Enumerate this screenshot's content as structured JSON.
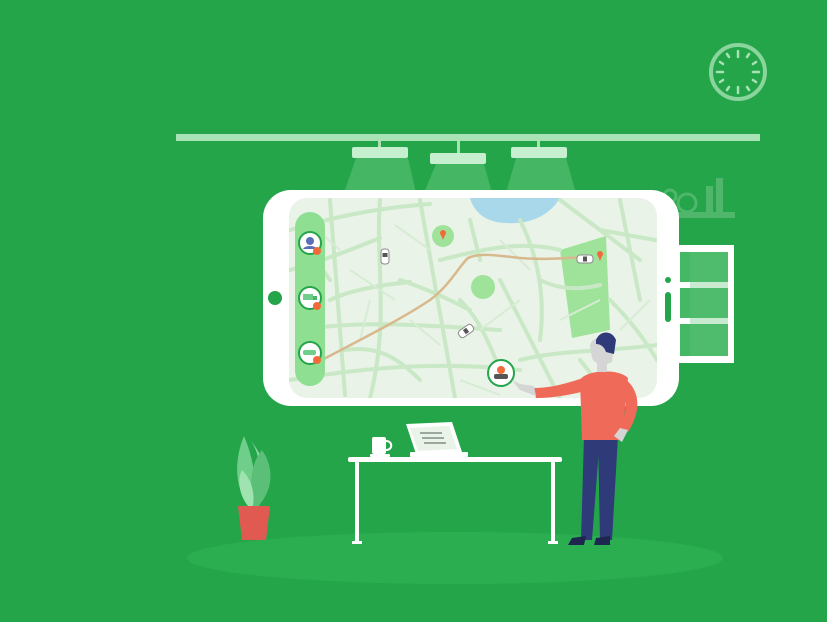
{
  "colors": {
    "background": "#24a54a",
    "floor": "#2aae50",
    "light_green": "#b6e8c0",
    "map_bg": "#e9f3e7",
    "map_road": "#c9e8c6",
    "map_park": "#9fe39a",
    "water": "#a8d8ea",
    "route": "#d8b98e",
    "shirt": "#f06a5a",
    "pants": "#2f3a78",
    "hair": "#2f3a78",
    "skin": "#d5d5d5",
    "pot": "#e05a52",
    "plant": "#6fcf8a"
  },
  "icons": {
    "clock": "clock-icon",
    "driver_markers": [
      "driver-avatar-icon",
      "truck-icon",
      "car-icon"
    ],
    "vehicles": [
      "car-icon",
      "car-icon",
      "car-icon"
    ],
    "pins": [
      "map-pin-icon",
      "map-pin-icon"
    ]
  }
}
